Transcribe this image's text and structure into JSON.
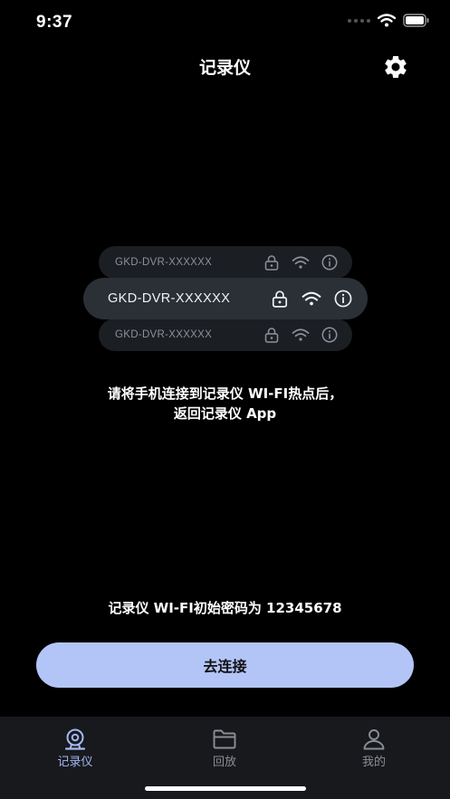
{
  "status_bar": {
    "time": "9:37"
  },
  "nav": {
    "title": "记录仪",
    "settings_icon": "gear-icon"
  },
  "wifi_examples": {
    "top_ssid": "GKD-DVR-XXXXXX",
    "main_ssid": "GKD-DVR-XXXXXX",
    "bottom_ssid": "GKD-DVR-XXXXXX"
  },
  "instruction": {
    "line1": "请将手机连接到记录仪 WI-FI热点后，",
    "line2": "返回记录仪 App"
  },
  "password_note": "记录仪 WI-FI初始密码为 12345678",
  "connect_button": {
    "label": "去连接"
  },
  "tabs": [
    {
      "label": "记录仪",
      "icon": "webcam-icon",
      "active": true
    },
    {
      "label": "回放",
      "icon": "folder-icon",
      "active": false
    },
    {
      "label": "我的",
      "icon": "person-icon",
      "active": false
    }
  ],
  "colors": {
    "accent": "#b3c5f7",
    "tab_active": "#a5b8f2",
    "tab_inactive": "#8a8d93",
    "background": "#000000"
  }
}
